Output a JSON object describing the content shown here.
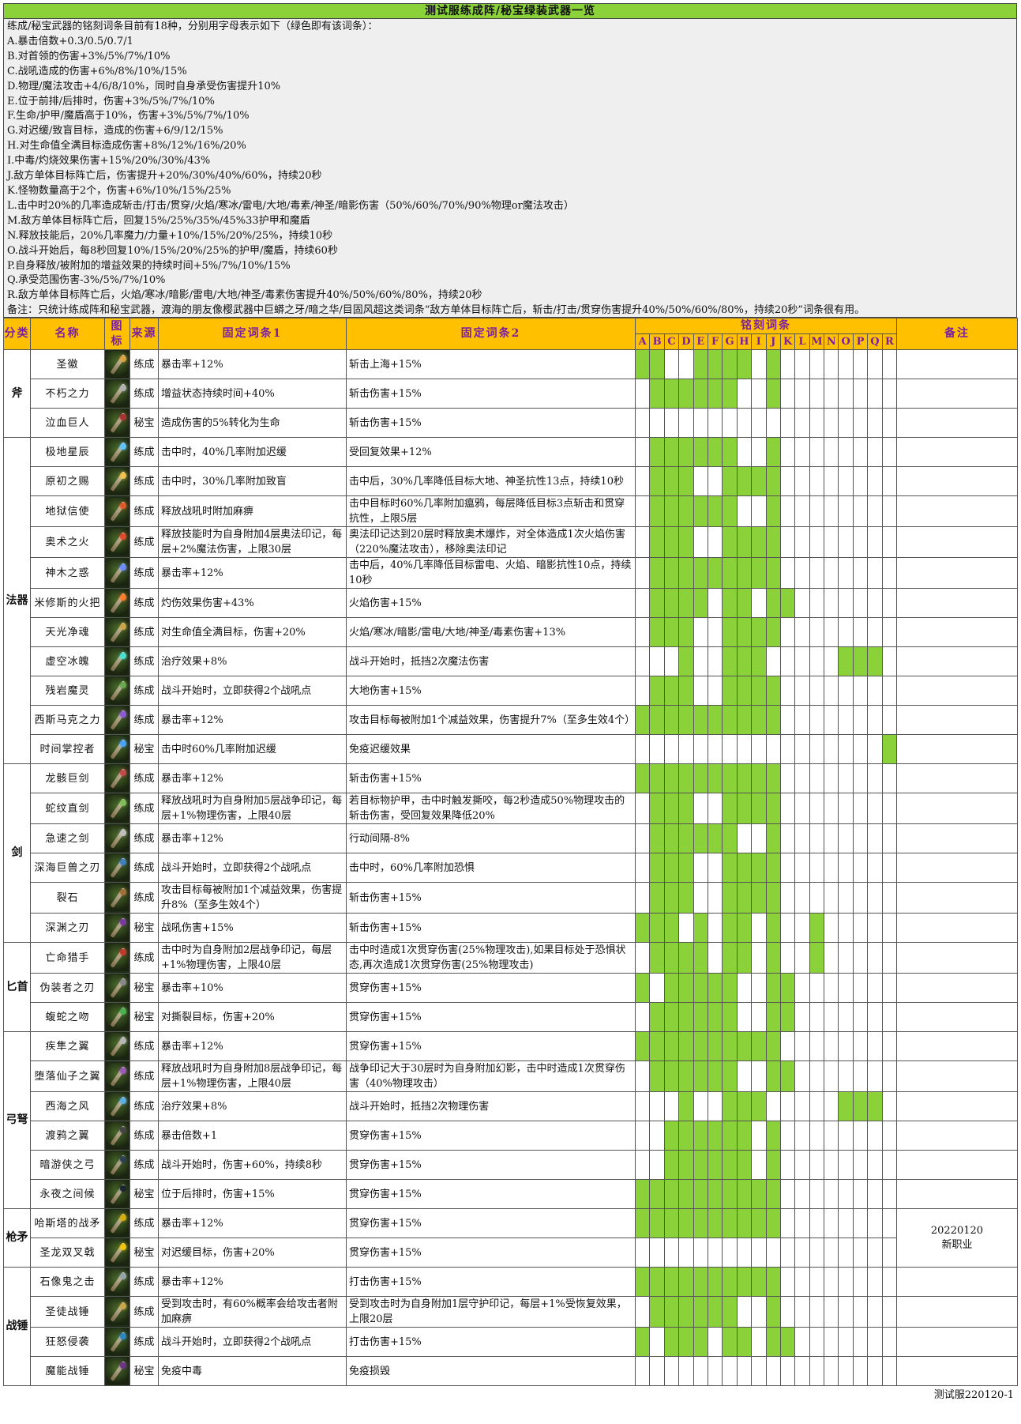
{
  "title": "测试服练成阵/秘宝绿装武器一览",
  "legend": [
    "练成/秘宝武器的铭刻词条目前有18种，分别用字母表示如下（绿色即有该词条）：",
    "A.暴击倍数+0.3/0.5/0.7/1",
    "B.对首领的伤害+3%/5%/7%/10%",
    "C.战吼造成的伤害+6%/8%/10%/15%",
    "D.物理/魔法攻击+4/6/8/10%，同时自身承受伤害提升10%",
    "E.位于前排/后排时，伤害+3%/5%/7%/10%",
    "F.生命/护甲/魔盾高于10%，伤害+3%/5%/7%/10%",
    "G.对迟缓/致盲目标，造成的伤害+6/9/12/15%",
    "H.对生命值全满目标造成伤害+8%/12%/16%/20%",
    "I.中毒/灼烧效果伤害+15%/20%/30%/43%",
    "J.敌方单体目标阵亡后，伤害提升+20%/30%/40%/60%，持续20秒",
    "K.怪物数量高于2个，伤害+6%/10%/15%/25%",
    "L.击中时20%的几率造成斩击/打击/贯穿/火焰/寒冰/雷电/大地/毒素/神圣/暗影伤害（50%/60%/70%/90%物理or魔法攻击）",
    "M.敌方单体目标阵亡后，回复15%/25%/35%/45%33护甲和魔盾",
    "N.释放技能后，20%几率魔力/力量+10%/15%/20%/25%，持续10秒",
    "O.战斗开始后，每8秒回复10%/15%/20%/25%的护甲/魔盾，持续60秒",
    "P.自身释放/被附加的增益效果的持续时间+5%/7%/10%/15%",
    "Q.承受范围伤害-3%/5%/7%/10%",
    "R.敌方单体目标阵亡后，火焰/寒冰/暗影/雷电/大地/神圣/毒素伤害提升40%/50%/60%/80%，持续20秒",
    "备注：只统计练成阵和秘宝武器，渡海的朋友像樱武器中巨蟒之牙/暗之华/目固风超这类词条“敌方单体目标阵亡后，斩击/打击/贯穿伤害提升40%/50%/60%/80%，持续20秒”词条很有用。"
  ],
  "headers": {
    "category": "分类",
    "name": "名称",
    "icon": "图标",
    "source": "来源",
    "fixed1": "固定词条1",
    "fixed2": "固定词条2",
    "engrave": "铭刻词条",
    "note": "备注"
  },
  "letters": [
    "A",
    "B",
    "C",
    "D",
    "E",
    "F",
    "G",
    "H",
    "I",
    "J",
    "K",
    "L",
    "M",
    "N",
    "O",
    "P",
    "Q",
    "R"
  ],
  "groups": [
    {
      "category": "斧",
      "rows": [
        {
          "name": "圣徽",
          "source": "练成",
          "fixed1": "暴击率+12%",
          "fixed2": "斩击上海+15%",
          "marks": "110011110100000000",
          "icon": "axe-icon",
          "gem": "#d9a441"
        },
        {
          "name": "不朽之力",
          "source": "练成",
          "fixed1": "增益状态持续时间+40%",
          "fixed2": "斩击伤害+15%",
          "marks": "011111100100000000",
          "icon": "axe-icon",
          "gem": "#b0b0b0"
        },
        {
          "name": "泣血巨人",
          "source": "秘宝",
          "fixed1": "造成伤害的5%转化为生命",
          "fixed2": "斩击伤害+15%",
          "marks": "000000000000000000",
          "icon": "axe-icon",
          "gem": "#a33"
        }
      ]
    },
    {
      "category": "法器",
      "rows": [
        {
          "name": "极地星辰",
          "source": "练成",
          "fixed1": "击中时，40%几率附加迟缓",
          "fixed2": "受回复效果+12%",
          "marks": "011111100100000000",
          "icon": "staff-icon",
          "gem": "#5fc3ff"
        },
        {
          "name": "原初之赐",
          "source": "练成",
          "fixed1": "击中时，30%几率附加致盲",
          "fixed2": "击中后，30%几率降低目标大地、神圣抗性13点，持续10秒",
          "marks": "011100111100000000",
          "icon": "staff-icon",
          "gem": "#f2c14e"
        },
        {
          "name": "地狱信使",
          "source": "练成",
          "fixed1": "释放战吼时附加麻痹",
          "fixed2": "击中目标时60%几率附加瘟鸦，每层降低目标3点斩击和贯穿抗性，上限5层",
          "marks": "011111100100000000",
          "icon": "staff-icon",
          "gem": "#e05a2a"
        },
        {
          "name": "奥术之火",
          "source": "练成",
          "fixed1": "释放技能时为自身附加4层奥法印记，每层+2%魔法伤害，上限30层",
          "fixed2": "奥法印记达到20层时释放奥术爆炸，对全体造成1次火焰伤害（220%魔法攻击），移除奥法印记",
          "marks": "011100111100000000",
          "icon": "staff-icon",
          "gem": "#e34b2c"
        },
        {
          "name": "神木之惑",
          "source": "练成",
          "fixed1": "暴击率+12%",
          "fixed2": "击中后，40%几率降低目标雷电、火焰、暗影抗性10点，持续10秒",
          "marks": "011111111100000000",
          "icon": "staff-icon",
          "gem": "#6c8cff"
        },
        {
          "name": "米修斯的火把",
          "source": "练成",
          "fixed1": "灼伤效果伤害+43%",
          "fixed2": "火焰伤害+15%",
          "marks": "011110110110000000",
          "icon": "staff-icon",
          "gem": "#ff7b2e"
        },
        {
          "name": "天光净魂",
          "source": "练成",
          "fixed1": "对生命值全满目标，伤害+20%",
          "fixed2": "火焰/寒冰/暗影/雷电/大地/神圣/毒素伤害+13%",
          "marks": "011100111100000000",
          "icon": "staff-icon",
          "gem": "#c9a64a"
        },
        {
          "name": "虚空冰魄",
          "source": "练成",
          "fixed1": "治疗效果+8%",
          "fixed2": "战斗开始时，抵挡2次魔法伤害",
          "marks": "000100111000001110",
          "icon": "staff-icon",
          "gem": "#49e0d0"
        },
        {
          "name": "残岩魔灵",
          "source": "练成",
          "fixed1": "战斗开始时，立即获得2个战吼点",
          "fixed2": "大地伤害+15%",
          "marks": "011100111100000000",
          "icon": "staff-icon",
          "gem": "#6aa84f"
        },
        {
          "name": "西斯马克之力",
          "source": "练成",
          "fixed1": "暴击率+12%",
          "fixed2": "攻击目标每被附加1个减益效果，伤害提升7%（至多生效4个）",
          "marks": "111111111100000000",
          "icon": "staff-icon",
          "gem": "#8e5ad8"
        },
        {
          "name": "时间掌控者",
          "source": "秘宝",
          "fixed1": "击中时60%几率附加迟缓",
          "fixed2": "免疫迟缓效果",
          "marks": "000000000000000001",
          "icon": "staff-icon",
          "gem": "#4aa3ff"
        }
      ]
    },
    {
      "category": "剑",
      "rows": [
        {
          "name": "龙骸巨剑",
          "source": "练成",
          "fixed1": "暴击率+12%",
          "fixed2": "斩击伤害+15%",
          "marks": "111111111100000000",
          "icon": "sword-icon",
          "gem": "#c24a4a"
        },
        {
          "name": "蛇纹直剑",
          "source": "练成",
          "fixed1": "释放战吼时为自身附加5层战争印记，每层+1%物理伤害，上限40层",
          "fixed2": "若目标物护甲，击中时触发撕咬，每2秒造成50%物理攻击的斩击伤害，受回复效果降低20%",
          "marks": "011100111100000000",
          "icon": "sword-icon",
          "gem": "#7fbf5a"
        },
        {
          "name": "急速之剑",
          "source": "练成",
          "fixed1": "暴击率+12%",
          "fixed2": "行动间隔-8%",
          "marks": "011111100100000000",
          "icon": "sword-icon",
          "gem": "#bfbfbf"
        },
        {
          "name": "深海巨兽之刃",
          "source": "练成",
          "fixed1": "战斗开始时，立即获得2个战吼点",
          "fixed2": "击中时，60%几率附加恐惧",
          "marks": "011100111100000000",
          "icon": "sword-icon",
          "gem": "#3f7fbf"
        },
        {
          "name": "裂石",
          "source": "练成",
          "fixed1": "攻击目标每被附加1个减益效果，伤害提升8%（至多生效4个）",
          "fixed2": "斩击伤害+15%",
          "marks": "011100111100000000",
          "icon": "sword-icon",
          "gem": "#a0703a"
        },
        {
          "name": "深渊之刃",
          "source": "秘宝",
          "fixed1": "战吼伤害+15%",
          "fixed2": "斩击伤害+15%",
          "marks": "111010110100100000",
          "icon": "sword-icon",
          "gem": "#7a3aa0"
        }
      ]
    },
    {
      "category": "匕首",
      "rows": [
        {
          "name": "亡命猎手",
          "source": "练成",
          "fixed1": "击中时为自身附加2层战争印记，每层+1%物理伤害，上限40层",
          "fixed2": "击中时造成1次贯穿伤害(25%物理攻击),如果目标处于恐惧状态,再次造成1次贯穿伤害(25%物理攻击)",
          "marks": "011110110100100000",
          "icon": "dagger-icon",
          "gem": "#c0392b"
        },
        {
          "name": "伪装者之刃",
          "source": "秘宝",
          "fixed1": "暴击率+10%",
          "fixed2": "贯穿伤害+15%",
          "marks": "101111100110000000",
          "icon": "dagger-icon",
          "gem": "#888"
        },
        {
          "name": "蝮蛇之吻",
          "source": "秘宝",
          "fixed1": "对撕裂目标，伤害+20%",
          "fixed2": "贯穿伤害+15%",
          "marks": "011111100110000000",
          "icon": "dagger-icon",
          "gem": "#4caf50"
        }
      ]
    },
    {
      "category": "弓弩",
      "rows": [
        {
          "name": "疾隼之翼",
          "source": "练成",
          "fixed1": "暴击率+12%",
          "fixed2": "贯穿伤害+15%",
          "marks": "111111111100000000",
          "icon": "bow-icon",
          "gem": "#b5b5b5"
        },
        {
          "name": "堕落仙子之翼",
          "source": "练成",
          "fixed1": "释放战吼时为自身附加8层战争印记，每层+1%物理伤害，上限40层",
          "fixed2": "战争印记大于30层时为自身附加幻影，击中时造成1次贯穿伤害（40%物理攻击）",
          "marks": "011111100110000000",
          "icon": "bow-icon",
          "gem": "#9b59b6"
        },
        {
          "name": "西海之风",
          "source": "练成",
          "fixed1": "治疗效果+8%",
          "fixed2": "战斗开始时，抵挡2次物理伤害",
          "marks": "000100111000001110",
          "icon": "bow-icon",
          "gem": "#5dade2"
        },
        {
          "name": "渡鸦之翼",
          "source": "练成",
          "fixed1": "暴击倍数+1",
          "fixed2": "贯穿伤害+15%",
          "marks": "001111110100000000",
          "icon": "bow-icon",
          "gem": "#444"
        },
        {
          "name": "暗游侠之弓",
          "source": "练成",
          "fixed1": "战斗开始时，伤害+60%，持续8秒",
          "fixed2": "贯穿伤害+15%",
          "marks": "001111110100000000",
          "icon": "bow-icon",
          "gem": "#2e4053"
        },
        {
          "name": "永夜之间候",
          "source": "秘宝",
          "fixed1": "位于后排时，伤害+15%",
          "fixed2": "贯穿伤害+15%",
          "marks": "111111111100000000",
          "icon": "bow-icon",
          "gem": "#1b2631"
        }
      ]
    },
    {
      "category": "枪矛",
      "note": [
        "20220120",
        "新职业"
      ],
      "rows": [
        {
          "name": "哈斯塔的战矛",
          "source": "练成",
          "fixed1": "暴击率+12%",
          "fixed2": "贯穿伤害+15%",
          "marks": "111111111100000000",
          "icon": "spear-icon",
          "gem": "#d4ac0d"
        },
        {
          "name": "圣龙双叉戟",
          "source": "秘宝",
          "fixed1": "对迟缓目标，伤害+20%",
          "fixed2": "贯穿伤害+15%",
          "marks": "000000000000000000",
          "icon": "spear-icon",
          "gem": "#f1c40f"
        }
      ]
    },
    {
      "category": "战锤",
      "rows": [
        {
          "name": "石像鬼之击",
          "source": "练成",
          "fixed1": "暴击率+12%",
          "fixed2": "打击伤害+15%",
          "marks": "111111111100000000",
          "icon": "hammer-icon",
          "gem": "#95a5a6"
        },
        {
          "name": "圣徒战锤",
          "source": "练成",
          "fixed1": "受到攻击时，有60%概率会给攻击者附加麻痹",
          "fixed2": "受到攻击时为自身附加1层守护印记，每层+1%受恢复效果，上限20层",
          "marks": "011111100100000000",
          "icon": "hammer-icon",
          "gem": "#c9a64a"
        },
        {
          "name": "狂怒侵袭",
          "source": "练成",
          "fixed1": "战斗开始时，立即获得2个战吼点",
          "fixed2": "打击伤害+15%",
          "marks": "101110110110000000",
          "icon": "hammer-icon",
          "gem": "#2e86c1"
        },
        {
          "name": "魔能战锤",
          "source": "秘宝",
          "fixed1": "免疫中毒",
          "fixed2": "免疫损毁",
          "marks": "000000000000000000",
          "icon": "hammer-icon",
          "gem": "#6c3483"
        }
      ]
    }
  ],
  "footer": "测试服220120-1",
  "colors": {
    "title_bg": "#8bd23a",
    "header_bg": "#ffc000",
    "header_text": "#7a1fa2",
    "mark_on": "#8bd23a",
    "legend_bg": "#efefef"
  }
}
